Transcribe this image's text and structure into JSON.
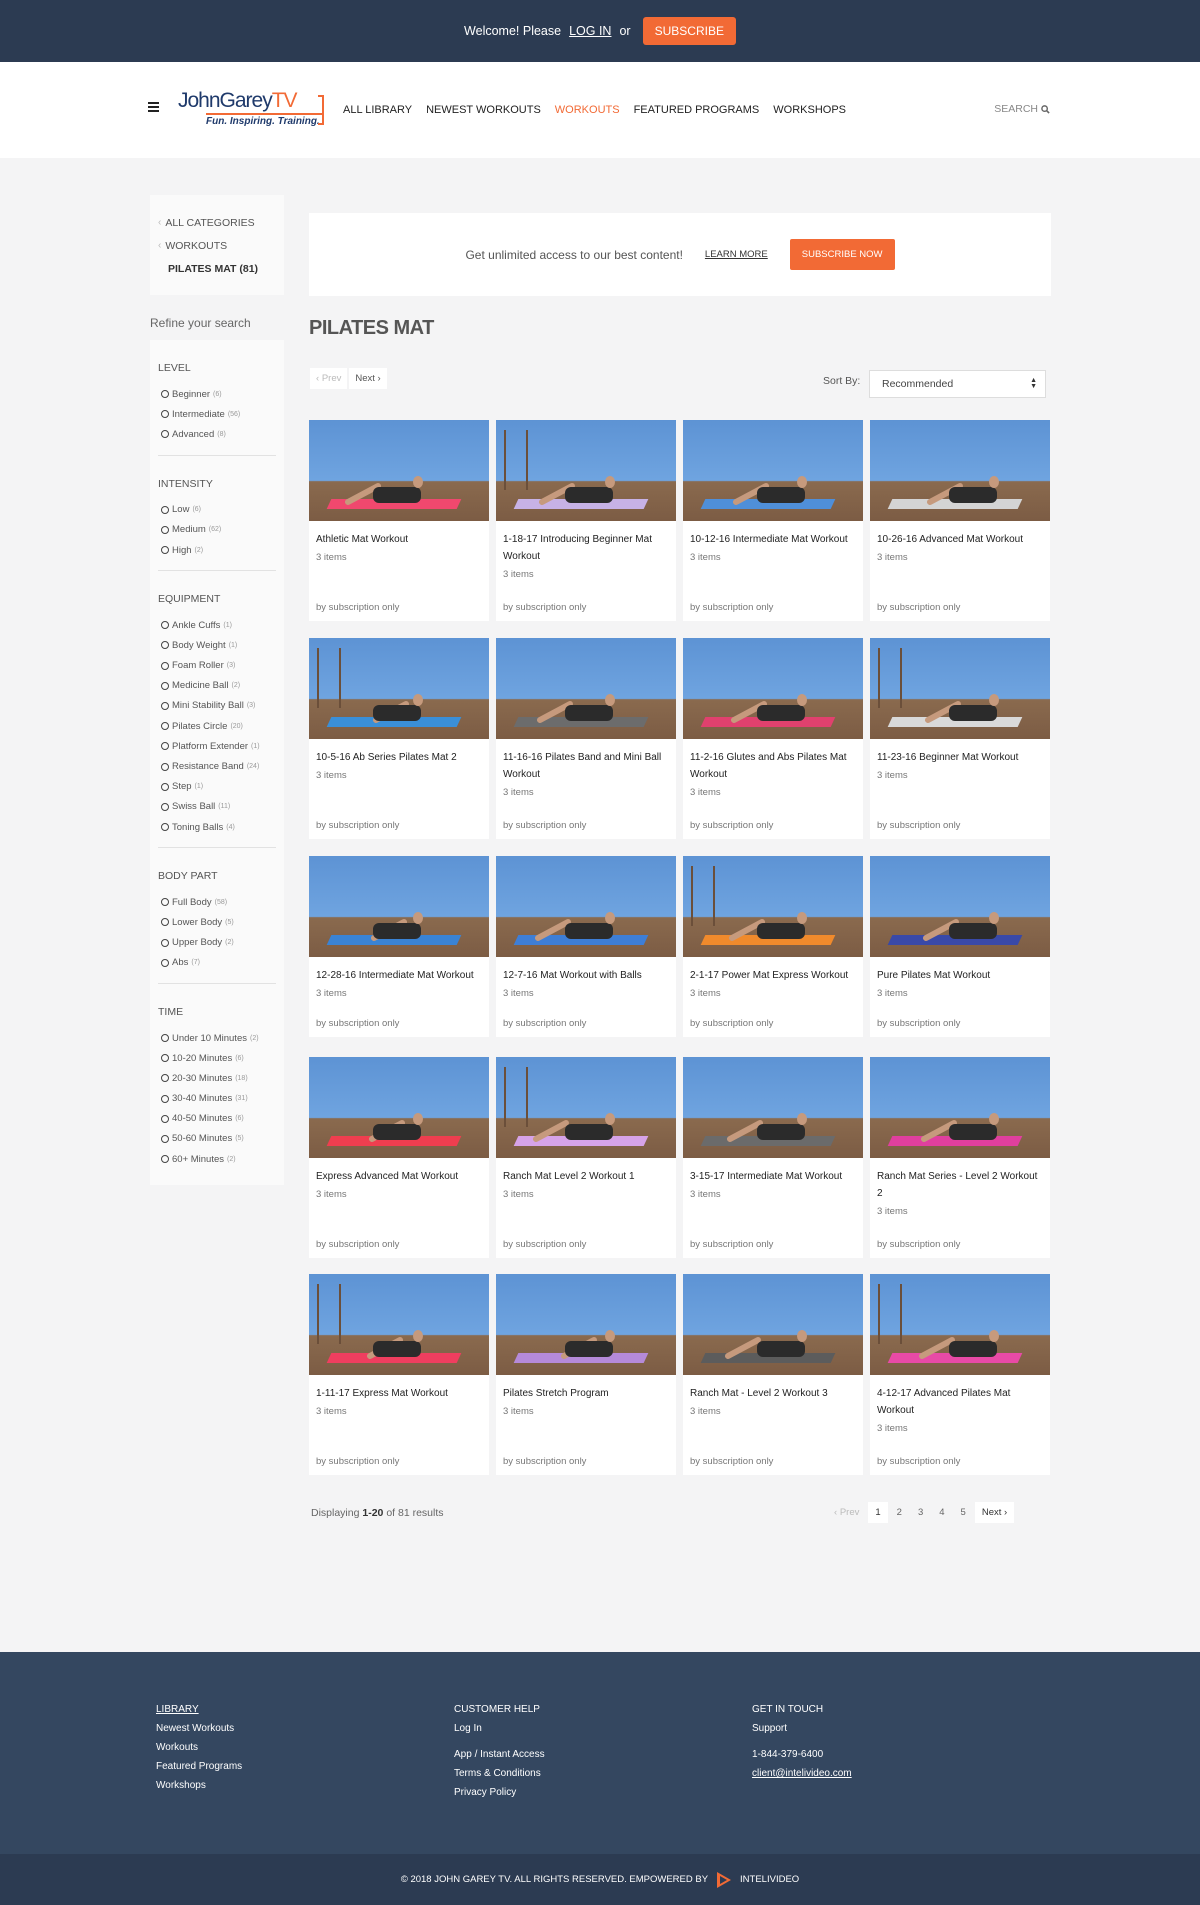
{
  "topbar": {
    "welcome": "Welcome! Please",
    "login": "LOG IN",
    "or": "or",
    "subscribe": "SUBSCRIBE"
  },
  "header": {
    "logo_main": "JohnGarey",
    "logo_tv": "TV",
    "logo_tagline": "Fun. Inspiring. Training.",
    "nav": [
      "ALL LIBRARY",
      "NEWEST WORKOUTS",
      "WORKOUTS",
      "FEATURED PROGRAMS",
      "WORKSHOPS"
    ],
    "active_nav": "WORKOUTS",
    "search": "SEARCH"
  },
  "categories": {
    "all": "ALL CATEGORIES",
    "workouts": "WORKOUTS",
    "current": "PILATES MAT (81)"
  },
  "refine_label": "Refine your search",
  "filters": [
    {
      "title": "LEVEL",
      "options": [
        [
          "Beginner",
          "(6)"
        ],
        [
          "Intermediate",
          "(56)"
        ],
        [
          "Advanced",
          "(8)"
        ]
      ]
    },
    {
      "title": "INTENSITY",
      "options": [
        [
          "Low",
          "(6)"
        ],
        [
          "Medium",
          "(62)"
        ],
        [
          "High",
          "(2)"
        ]
      ]
    },
    {
      "title": "EQUIPMENT",
      "options": [
        [
          "Ankle Cuffs",
          "(1)"
        ],
        [
          "Body Weight",
          "(1)"
        ],
        [
          "Foam Roller",
          "(3)"
        ],
        [
          "Medicine Ball",
          "(2)"
        ],
        [
          "Mini Stability Ball",
          "(3)"
        ],
        [
          "Pilates Circle",
          "(20)"
        ],
        [
          "Platform Extender",
          "(1)"
        ],
        [
          "Resistance Band",
          "(24)"
        ],
        [
          "Step",
          "(1)"
        ],
        [
          "Swiss Ball",
          "(11)"
        ],
        [
          "Toning Balls",
          "(4)"
        ]
      ]
    },
    {
      "title": "BODY PART",
      "options": [
        [
          "Full Body",
          "(58)"
        ],
        [
          "Lower Body",
          "(5)"
        ],
        [
          "Upper Body",
          "(2)"
        ],
        [
          "Abs",
          "(7)"
        ]
      ]
    },
    {
      "title": "TIME",
      "options": [
        [
          "Under 10 Minutes",
          "(2)"
        ],
        [
          "10-20 Minutes",
          "(6)"
        ],
        [
          "20-30 Minutes",
          "(18)"
        ],
        [
          "30-40 Minutes",
          "(31)"
        ],
        [
          "40-50 Minutes",
          "(6)"
        ],
        [
          "50-60 Minutes",
          "(5)"
        ],
        [
          "60+ Minutes",
          "(2)"
        ]
      ]
    }
  ],
  "promo": {
    "text": "Get unlimited access to our best content!",
    "learn_more": "LEARN MORE",
    "subscribe_now": "SUBSCRIBE NOW"
  },
  "page_title": "PILATES MAT",
  "pager_top": {
    "prev": "Prev",
    "next": "Next"
  },
  "sort": {
    "label": "Sort By:",
    "value": "Recommended"
  },
  "cards": [
    {
      "title": "Athletic Mat Workout",
      "items": "3 items",
      "access": "by subscription only",
      "mat": "#f0486e"
    },
    {
      "title": "1-18-17 Introducing Beginner Mat Workout",
      "items": "3 items",
      "access": "by subscription only",
      "mat": "#c7b2e6"
    },
    {
      "title": "10-12-16 Intermediate Mat Workout",
      "items": "3 items",
      "access": "by subscription only",
      "mat": "#4f8fd9"
    },
    {
      "title": "10-26-16 Advanced Mat Workout",
      "items": "3 items",
      "access": "by subscription only",
      "mat": "#d4d4d4"
    },
    {
      "title": "10-5-16 Ab Series Pilates Mat 2",
      "items": "3 items",
      "access": "by subscription only",
      "mat": "#3a8fd8"
    },
    {
      "title": "11-16-16 Pilates Band and Mini Ball Workout",
      "items": "3 items",
      "access": "by subscription only",
      "mat": "#6c6c6c"
    },
    {
      "title": "11-2-16 Glutes and Abs Pilates Mat Workout",
      "items": "3 items",
      "access": "by subscription only",
      "mat": "#e0416e"
    },
    {
      "title": "11-23-16 Beginner Mat Workout",
      "items": "3 items",
      "access": "by subscription only",
      "mat": "#d9d9d9"
    },
    {
      "title": "12-28-16 Intermediate Mat Workout",
      "items": "3 items",
      "access": "by subscription only",
      "mat": "#3a83d4"
    },
    {
      "title": "12-7-16 Mat Workout with Balls",
      "items": "3 items",
      "access": "by subscription only",
      "mat": "#3e7ed6"
    },
    {
      "title": "2-1-17 Power Mat Express Workout",
      "items": "3 items",
      "access": "by subscription only",
      "mat": "#f08a2c"
    },
    {
      "title": "Pure Pilates Mat Workout",
      "items": "3 items",
      "access": "by subscription only",
      "mat": "#3949a8"
    },
    {
      "title": "Express Advanced Mat Workout",
      "items": "3 items",
      "access": "by subscription only",
      "mat": "#ef3e4f"
    },
    {
      "title": "Ranch Mat Level 2 Workout 1",
      "items": "3 items",
      "access": "by subscription only",
      "mat": "#d6a3e8"
    },
    {
      "title": "3-15-17 Intermediate Mat Workout",
      "items": "3 items",
      "access": "by subscription only",
      "mat": "#6b6b6b"
    },
    {
      "title": "Ranch Mat Series - Level 2 Workout 2",
      "items": "3 items",
      "access": "by subscription only",
      "mat": "#e03f9e"
    },
    {
      "title": "1-11-17 Express Mat Workout",
      "items": "3 items",
      "access": "by subscription only",
      "mat": "#ef3e5f"
    },
    {
      "title": "Pilates Stretch Program",
      "items": "3 items",
      "access": "by subscription only",
      "mat": "#b58ad9"
    },
    {
      "title": "Ranch Mat - Level 2 Workout 3",
      "items": "3 items",
      "access": "by subscription only",
      "mat": "#5c5c5c"
    },
    {
      "title": "4-12-17 Advanced Pilates Mat Workout",
      "items": "3 items",
      "access": "by subscription only",
      "mat": "#e84aa6"
    }
  ],
  "results": {
    "prefix": "Displaying",
    "range": "1-20",
    "suffix": "of 81 results"
  },
  "pager_bottom": {
    "prev": "Prev",
    "pages": [
      "1",
      "2",
      "3",
      "4",
      "5"
    ],
    "current": "1",
    "next": "Next"
  },
  "footer": {
    "col1": [
      "LIBRARY",
      "Newest Workouts",
      "Workouts",
      "Featured Programs",
      "Workshops"
    ],
    "col2": [
      "CUSTOMER HELP",
      "Log In",
      "App / Instant Access",
      "Terms & Conditions",
      "Privacy Policy"
    ],
    "col3": [
      "GET IN TOUCH",
      "Support",
      "1-844-379-6400",
      "client@intelivideo.com"
    ],
    "copyright": "© 2018 JOHN GAREY TV. ALL RIGHTS RESERVED. EMPOWERED BY",
    "brand": "INTELIVIDEO"
  },
  "colors": {
    "accent": "#f26a35",
    "topbar": "#2c3b52",
    "footer": "#344760"
  }
}
